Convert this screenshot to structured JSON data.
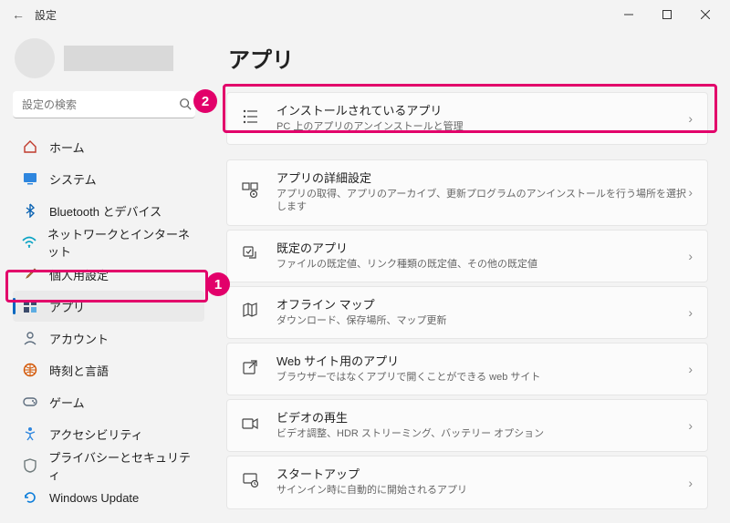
{
  "window": {
    "title": "設定"
  },
  "search": {
    "placeholder": "設定の検索"
  },
  "nav": [
    {
      "label": "ホーム"
    },
    {
      "label": "システム"
    },
    {
      "label": "Bluetooth とデバイス"
    },
    {
      "label": "ネットワークとインターネット"
    },
    {
      "label": "個人用設定"
    },
    {
      "label": "アプリ"
    },
    {
      "label": "アカウント"
    },
    {
      "label": "時刻と言語"
    },
    {
      "label": "ゲーム"
    },
    {
      "label": "アクセシビリティ"
    },
    {
      "label": "プライバシーとセキュリティ"
    },
    {
      "label": "Windows Update"
    }
  ],
  "page": {
    "title": "アプリ"
  },
  "cards": [
    {
      "title": "インストールされているアプリ",
      "sub": "PC 上のアプリのアンインストールと管理"
    },
    {
      "title": "アプリの詳細設定",
      "sub": "アプリの取得、アプリのアーカイブ、更新プログラムのアンインストールを行う場所を選択します"
    },
    {
      "title": "既定のアプリ",
      "sub": "ファイルの既定値、リンク種類の既定値、その他の既定値"
    },
    {
      "title": "オフライン マップ",
      "sub": "ダウンロード、保存場所、マップ更新"
    },
    {
      "title": "Web サイト用のアプリ",
      "sub": "ブラウザーではなくアプリで開くことができる web サイト"
    },
    {
      "title": "ビデオの再生",
      "sub": "ビデオ調整、HDR ストリーミング、バッテリー オプション"
    },
    {
      "title": "スタートアップ",
      "sub": "サインイン時に自動的に開始されるアプリ"
    }
  ],
  "annotations": {
    "badge1": "1",
    "badge2": "2"
  }
}
